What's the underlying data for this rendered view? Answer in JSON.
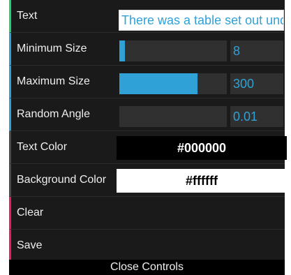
{
  "controls": {
    "text": {
      "label": "Text",
      "value": "There was a table set out under a tree"
    },
    "min_size": {
      "label": "Minimum Size",
      "value": "8",
      "fill": 0.05
    },
    "max_size": {
      "label": "Maximum Size",
      "value": "300",
      "fill": 0.73
    },
    "random_angle": {
      "label": "Random Angle",
      "value": "0.01",
      "fill": 0.0
    },
    "text_color": {
      "label": "Text Color",
      "value": "#000000",
      "swatch": "#000000",
      "text_fg": "#ffffff"
    },
    "bg_color": {
      "label": "Background Color",
      "value": "#ffffff",
      "swatch": "#ffffff",
      "text_fg": "#000000"
    },
    "clear": {
      "label": "Clear"
    },
    "save": {
      "label": "Save"
    }
  },
  "close_label": "Close Controls",
  "colors": {
    "accent": "#2fa1d6",
    "string_border": "#1ed36f",
    "function_border": "#e61d5f",
    "panel_bg": "#1a1a1a"
  }
}
